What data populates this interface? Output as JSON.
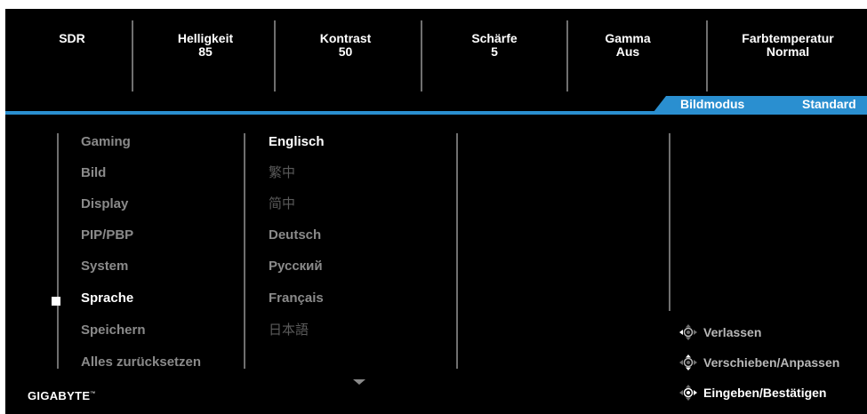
{
  "top_stats": [
    {
      "label": "SDR",
      "value": ""
    },
    {
      "label": "Helligkeit",
      "value": "85"
    },
    {
      "label": "Kontrast",
      "value": "50"
    },
    {
      "label": "Schärfe",
      "value": "5"
    },
    {
      "label": "Gamma",
      "value": "Aus"
    },
    {
      "label": "Farbtemperatur",
      "value": "Normal"
    }
  ],
  "picture_mode": {
    "label": "Bildmodus",
    "value": "Standard"
  },
  "main_menu": [
    "Gaming",
    "Bild",
    "Display",
    "PIP/PBP",
    "System",
    "Sprache",
    "Speichern",
    "Alles zurücksetzen"
  ],
  "selected_menu": "Sprache",
  "languages": [
    "Englisch",
    "繁中",
    "简中",
    "Deutsch",
    "Русский",
    "Français",
    "日本語"
  ],
  "selected_language": "Englisch",
  "hints": [
    "Verlassen",
    "Verschieben/Anpassen",
    "Eingeben/Bestätigen"
  ],
  "hint_icons": [
    "joystick-left-icon",
    "joystick-updown-icon",
    "joystick-press-icon"
  ],
  "logo": {
    "text": "GIGABYTE",
    "tm": "™"
  },
  "colors": {
    "accent": "#2a8fd0",
    "background": "#000000",
    "text_active": "#ffffff",
    "text_dim": "#8a8a8a"
  }
}
